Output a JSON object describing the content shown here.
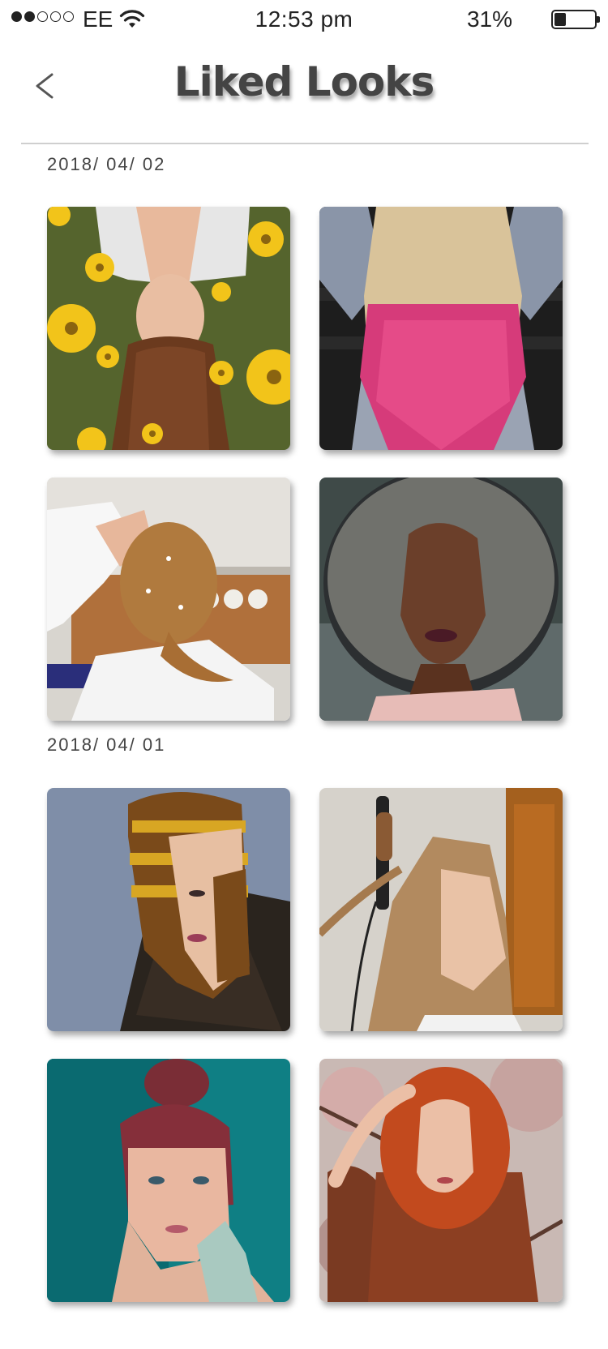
{
  "status_bar": {
    "carrier": "EE",
    "time": "12:53 pm",
    "battery_percent": "31%",
    "battery_level": 0.31,
    "signal_bars_filled": 2,
    "signal_bars_total": 5,
    "icons": [
      "wifi-icon",
      "battery-icon"
    ]
  },
  "header": {
    "title": "Liked Looks",
    "back_icon": "chevron-left-icon"
  },
  "groups": [
    {
      "date": "2018/ 04/ 02",
      "looks": [
        {
          "name": "look-flowers-upside-down"
        },
        {
          "name": "look-pink-ombre"
        },
        {
          "name": "look-salon-braided-updo"
        },
        {
          "name": "look-silver-curls"
        }
      ]
    },
    {
      "date": "2018/ 04/ 01",
      "looks": [
        {
          "name": "look-striped-bob"
        },
        {
          "name": "look-curling-iron"
        },
        {
          "name": "look-top-bun"
        },
        {
          "name": "look-red-curls"
        }
      ]
    }
  ]
}
